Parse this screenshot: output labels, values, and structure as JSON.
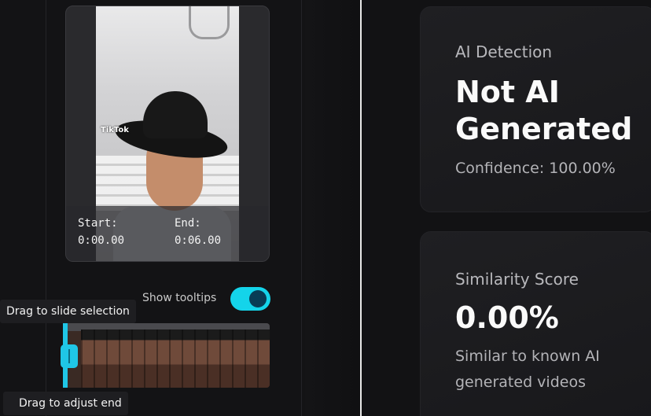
{
  "video_preview": {
    "start_label": "Start:",
    "start_time": "0:00.00",
    "end_label": "End:",
    "end_time": "0:06.00",
    "watermark": "TikTok"
  },
  "tooltips_toggle": {
    "label": "Show tooltips",
    "enabled": true
  },
  "tooltips": {
    "slide_selection": "Drag to slide selection",
    "adjust_end": "Drag to adjust end"
  },
  "colors": {
    "accent": "#14d4ea",
    "toggle_knob": "#083c55"
  },
  "ai_detection": {
    "title": "AI Detection",
    "result_line1": "Not AI",
    "result_line2": "Generated",
    "confidence": "Confidence: 100.00%"
  },
  "similarity": {
    "title": "Similarity Score",
    "score": "0.00%",
    "desc_line1": "Similar to known AI",
    "desc_line2": "generated videos"
  }
}
